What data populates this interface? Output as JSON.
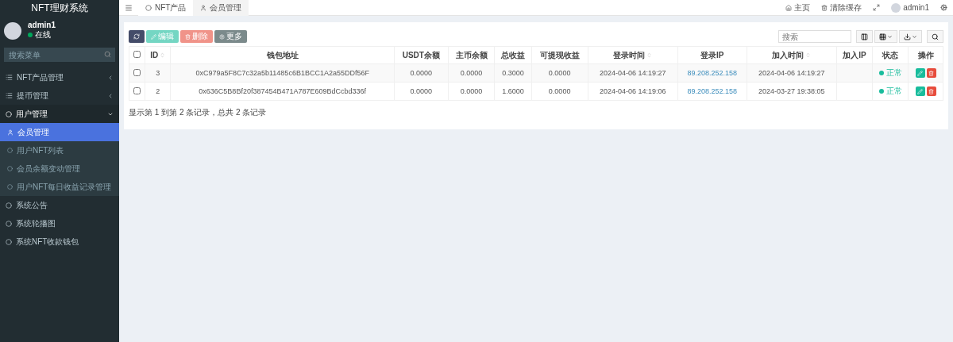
{
  "app_title": "NFT理财系统",
  "user_panel": {
    "name": "admin1",
    "status": "在线",
    "online": true
  },
  "sidebar_search": {
    "placeholder": "搜索菜单"
  },
  "menu": [
    {
      "label": "NFT产品管理",
      "kind": "folder",
      "expanded": false
    },
    {
      "label": "提币管理",
      "kind": "folder",
      "expanded": false
    },
    {
      "label": "用户管理",
      "kind": "section",
      "expanded": true,
      "children": [
        {
          "label": "会员管理",
          "selected": true
        },
        {
          "label": "用户NFT列表",
          "selected": false
        },
        {
          "label": "会员余额变动管理",
          "selected": false
        },
        {
          "label": "用户NFT每日收益记录管理",
          "selected": false
        }
      ]
    },
    {
      "label": "系统公告",
      "kind": "link"
    },
    {
      "label": "系统轮播图",
      "kind": "link"
    },
    {
      "label": "系统NFT收款钱包",
      "kind": "link"
    }
  ],
  "tabs": [
    {
      "label": "NFT产品",
      "selected": false
    },
    {
      "label": "会员管理",
      "selected": true
    }
  ],
  "top_links": [
    {
      "label": "主页",
      "kind": "home"
    },
    {
      "label": "清除缓存",
      "kind": "trash"
    }
  ],
  "top_user": "admin1",
  "toolbar": [
    {
      "kind": "refresh",
      "disabled": false
    },
    {
      "kind": "edit",
      "label": "编辑",
      "disabled": true
    },
    {
      "kind": "delete",
      "label": "删除",
      "disabled": true
    },
    {
      "kind": "more",
      "label": "更多",
      "disabled": false
    }
  ],
  "table_search": {
    "placeholder": "搜索"
  },
  "table": {
    "all_checked": false,
    "columns": [
      {
        "label": "ID",
        "sortable": true
      },
      {
        "label": "钱包地址",
        "sortable": false
      },
      {
        "label": "USDT余额",
        "sortable": false
      },
      {
        "label": "主币余额",
        "sortable": false
      },
      {
        "label": "总收益",
        "sortable": false
      },
      {
        "label": "可提现收益",
        "sortable": false
      },
      {
        "label": "登录时间",
        "sortable": true
      },
      {
        "label": "登录IP",
        "sortable": false
      },
      {
        "label": "加入时间",
        "sortable": true
      },
      {
        "label": "加入IP",
        "sortable": false
      },
      {
        "label": "状态",
        "sortable": false
      },
      {
        "label": "操作",
        "sortable": false
      }
    ],
    "rows": [
      {
        "checked": false,
        "id": "3",
        "wallet": "0xC979a5F8C7c32a5b11485c6B1BCC1A2a55DDf56F",
        "usdt": "0.0000",
        "coin": "0.0000",
        "total": "0.3000",
        "withdrawable": "0.0000",
        "login_time": "2024-04-06 14:19:27",
        "login_ip": "89.208.252.158",
        "join_time": "2024-04-06 14:19:27",
        "status": "正常",
        "color": "#18bc9c"
      },
      {
        "checked": false,
        "id": "2",
        "wallet": "0x636C5B8Bf20f387454B471A787E609BdCcbd336f",
        "usdt": "0.0000",
        "coin": "0.0000",
        "total": "1.6000",
        "withdrawable": "0.0000",
        "login_time": "2024-04-06 14:19:06",
        "login_ip": "89.208.252.158",
        "join_time": "2024-03-27 19:38:05",
        "status": "正常",
        "color": "#18bc9c"
      }
    ]
  },
  "pagination_info": "显示第 1 到第 2 条记录，总共 2 条记录"
}
